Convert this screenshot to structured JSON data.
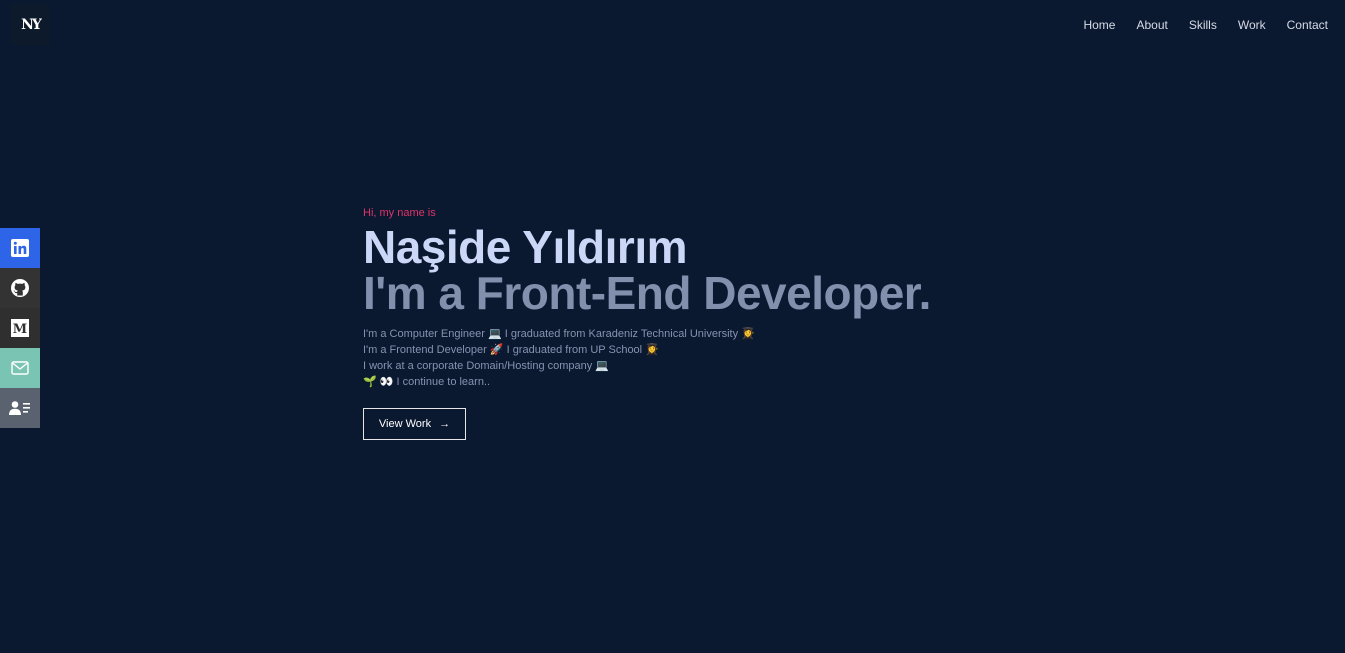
{
  "logo": {
    "text": "NY"
  },
  "nav": {
    "items": [
      {
        "label": "Home"
      },
      {
        "label": "About"
      },
      {
        "label": "Skills"
      },
      {
        "label": "Work"
      },
      {
        "label": "Contact"
      }
    ]
  },
  "social": {
    "items": [
      {
        "icon": "linkedin-icon",
        "color": "#2d64e8"
      },
      {
        "icon": "github-icon",
        "color": "#333333"
      },
      {
        "icon": "medium-icon",
        "color": "#2f2f2f"
      },
      {
        "icon": "mail-icon",
        "color": "#7ac4b4"
      },
      {
        "icon": "contact-card-icon",
        "color": "#5a6270"
      }
    ]
  },
  "hero": {
    "greeting": "Hi, my name is",
    "name": "Naşide Yıldırım",
    "role": "I'm a Front-End Developer.",
    "bio": [
      "I'm a Computer Engineer 💻 I graduated from Karadeniz Technical University 👩‍🎓",
      "I'm a Frontend Developer 🚀 I graduated from UP School 👩‍🎓",
      "I work at a corporate Domain/Hosting company 💻",
      "🌱 👀 I continue to learn.."
    ],
    "button_label": "View Work",
    "button_arrow": "→"
  },
  "colors": {
    "background": "#0a1830",
    "accent": "#e0346a",
    "name": "#ccd6f6",
    "role": "#8390ad"
  }
}
